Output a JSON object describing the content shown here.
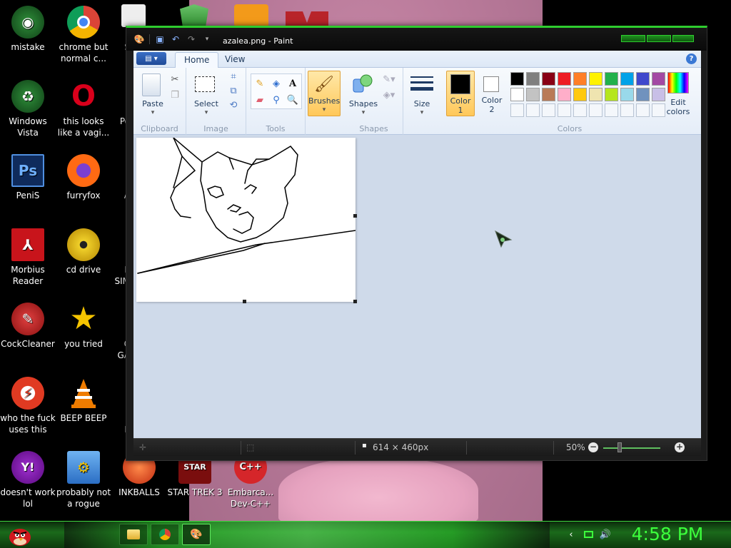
{
  "desktop": {
    "icons": [
      {
        "label": "mistake",
        "color": "#1f6f2a",
        "glyph": "◉"
      },
      {
        "label": "chrome but normal c...",
        "color": "#dd3b2f",
        "glyph": "◎"
      },
      {
        "label": "Windows Vista",
        "color": "#1f6f2a",
        "glyph": "♻"
      },
      {
        "label": "this looks like a vagi...",
        "color": "#d9001b",
        "glyph": "O"
      },
      {
        "label": "PeniS",
        "color": "#1b3f8f",
        "glyph": "Ps"
      },
      {
        "label": "furryfox",
        "color": "#ff6a13",
        "glyph": "🦊"
      },
      {
        "label": "Morbius Reader",
        "color": "#c8141b",
        "glyph": "⅄"
      },
      {
        "label": "cd drive",
        "color": "#e2c21a",
        "glyph": "◉"
      },
      {
        "label": "CockCleaner",
        "color": "#c4262a",
        "glyph": "✎"
      },
      {
        "label": "you tried",
        "color": "#f5c400",
        "glyph": "★"
      },
      {
        "label": "who the fuck uses this",
        "color": "#e03a22",
        "glyph": "⚡"
      },
      {
        "label": "BEEP BEEP",
        "color": "#ef7c00",
        "glyph": "▲"
      },
      {
        "label": "doesn't work lol",
        "color": "#7b0ea8",
        "glyph": "Y!"
      },
      {
        "label": "probably not a rogue",
        "color": "#3a8ee6",
        "glyph": "⚙"
      },
      {
        "label": "INKBALLS",
        "color": "#e0461e",
        "glyph": "●"
      },
      {
        "label": "STAR TREK 3",
        "color": "#9c1212",
        "glyph": "⭐"
      },
      {
        "label": "Embarca... Dev-C++",
        "color": "#d5262a",
        "glyph": "C++"
      }
    ],
    "partial_icon_labels": [
      "S",
      "Po",
      "A",
      "E",
      "SIM",
      "C",
      "GA",
      "E"
    ]
  },
  "window": {
    "title": "azalea.png - Paint"
  },
  "ribbon": {
    "tabs": [
      "Home",
      "View"
    ],
    "groups": {
      "clipboard": {
        "name": "Clipboard",
        "paste": "Paste"
      },
      "image": {
        "name": "Image",
        "select": "Select"
      },
      "tools": {
        "name": "Tools"
      },
      "brushes": {
        "label": "Brushes"
      },
      "shapes": {
        "name": "Shapes",
        "label": "Shapes"
      },
      "size": {
        "label": "Size"
      },
      "colors": {
        "name": "Colors",
        "color1": "Color\n1",
        "color1_line1": "Color",
        "color1_line2": "1",
        "color2_line1": "Color",
        "color2_line2": "2",
        "edit_line1": "Edit",
        "edit_line2": "colors",
        "palette_row1": [
          "#000000",
          "#7f7f7f",
          "#880015",
          "#ed1c24",
          "#ff7f27",
          "#fff200",
          "#22b14c",
          "#00a2e8",
          "#3f48cc",
          "#a349a4"
        ],
        "palette_row2": [
          "#ffffff",
          "#c3c3c3",
          "#b97a57",
          "#ffaec9",
          "#ffc90e",
          "#efe4b0",
          "#b5e61d",
          "#99d9ea",
          "#7092be",
          "#c8bfe7"
        ]
      }
    }
  },
  "status": {
    "image_size": "614 × 460px",
    "zoom": "50%"
  },
  "taskbar": {
    "clock": "4:58 PM"
  }
}
